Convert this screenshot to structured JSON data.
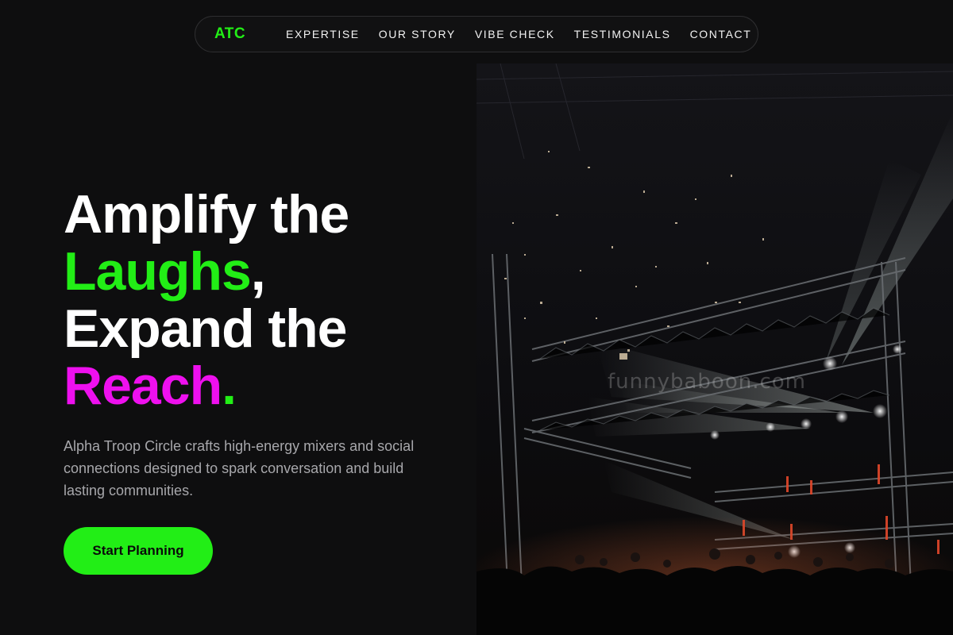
{
  "colors": {
    "background": "#0e0e0f",
    "accent_green": "#22ee16",
    "accent_magenta": "#ee10ee",
    "body_text": "#a7a7ab"
  },
  "nav": {
    "logo": "ATC",
    "links": [
      "EXPERTISE",
      "OUR STORY",
      "VIBE CHECK",
      "TESTIMONIALS",
      "CONTACT"
    ]
  },
  "hero": {
    "headline": {
      "line1": "Amplify the",
      "line2_accent": "Laughs",
      "line2_punct": ",",
      "line3": "Expand the",
      "line4_accent": "Reach",
      "line4_punct": "."
    },
    "subtext": "Alpha Troop Circle crafts high-energy mixers and social connections designed to spark conversation and build lasting communities.",
    "cta_label": "Start Planning",
    "image": {
      "watermark": "funnybaboon.com"
    }
  }
}
